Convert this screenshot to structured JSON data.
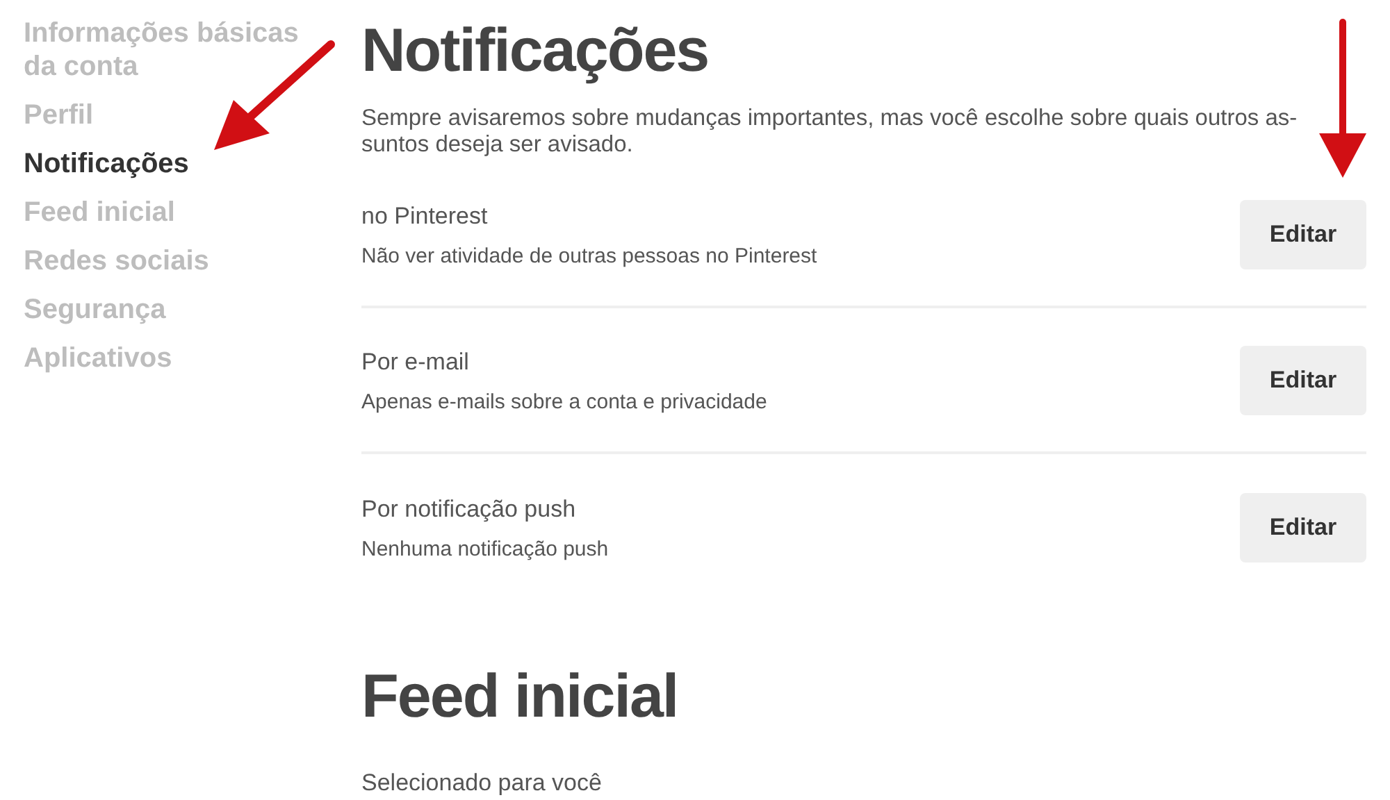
{
  "sidebar": {
    "items": [
      {
        "label": "Informações básicas da conta",
        "selected": false
      },
      {
        "label": "Perfil",
        "selected": false
      },
      {
        "label": "Notificações",
        "selected": true
      },
      {
        "label": "Feed inicial",
        "selected": false
      },
      {
        "label": "Redes sociais",
        "selected": false
      },
      {
        "label": "Segurança",
        "selected": false
      },
      {
        "label": "Aplicativos",
        "selected": false
      }
    ]
  },
  "notifications": {
    "title": "Notificações",
    "description": "Sempre avisaremos sobre mudanças importantes, mas você escolhe sobre quais outros as-suntos deseja ser avisado.",
    "rows": [
      {
        "label": "no Pinterest",
        "value": "Não ver atividade de outras pessoas no Pinterest",
        "button": "Editar"
      },
      {
        "label": "Por e-mail",
        "value": "Apenas e-mails sobre a conta e privacidade",
        "button": "Editar"
      },
      {
        "label": "Por notificação push",
        "value": "Nenhuma notificação push",
        "button": "Editar"
      }
    ]
  },
  "feed": {
    "title": "Feed inicial",
    "rows": [
      {
        "label": "Selecionado para você"
      }
    ]
  }
}
